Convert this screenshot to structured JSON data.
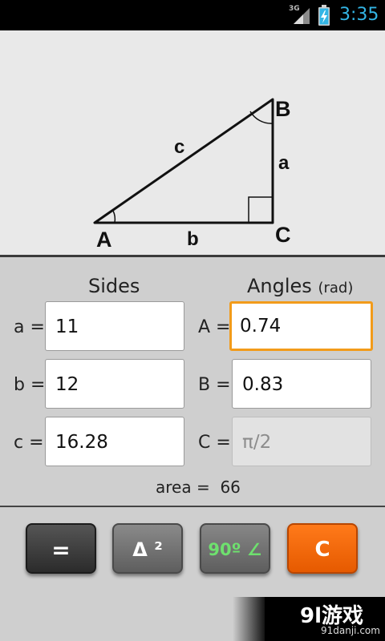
{
  "status_bar": {
    "network": "3G",
    "time": "3:35",
    "icons": [
      "signal-icon",
      "battery-charging-icon"
    ],
    "time_color": "#33b5e5"
  },
  "diagram": {
    "vertex_labels": {
      "A": "A",
      "B": "B",
      "C": "C"
    },
    "side_labels": {
      "a": "a",
      "b": "b",
      "c": "c"
    }
  },
  "sides": {
    "heading": "Sides",
    "rows": [
      {
        "label": "a =",
        "value": "11"
      },
      {
        "label": "b =",
        "value": "12"
      },
      {
        "label": "c =",
        "value": "16.28"
      }
    ]
  },
  "angles": {
    "heading": "Angles",
    "unit": "(rad)",
    "rows": [
      {
        "label": "A =",
        "value": "0.74",
        "focused": true
      },
      {
        "label": "B =",
        "value": "0.83"
      },
      {
        "label": "C =",
        "value": "π/2",
        "disabled": true
      }
    ]
  },
  "area": {
    "label": "area =",
    "value": "66"
  },
  "buttons": {
    "solve": "=",
    "square": "Δ ²",
    "right_angle": "90º ∠",
    "clear": "C"
  },
  "watermark": {
    "main": "9l游戏",
    "sub": "91danji.com"
  },
  "colors": {
    "focus_border": "#f29b1a",
    "clear_button": "#ff6e0f",
    "right_angle_text": "#6ee06e"
  }
}
